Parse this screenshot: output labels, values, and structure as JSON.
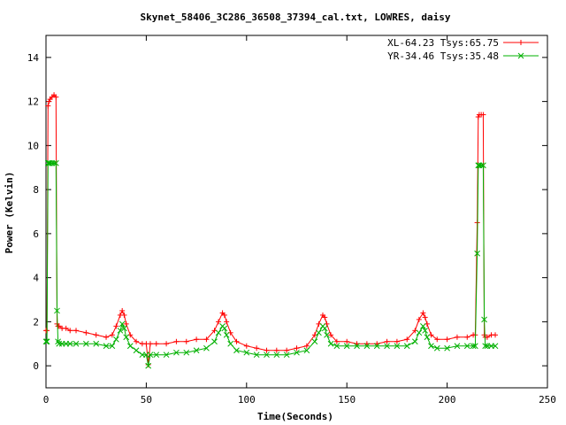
{
  "chart_data": {
    "type": "line",
    "title": "Skynet_58406_3C286_36508_37394_cal.txt, LOWRES, daisy",
    "xlabel": "Time(Seconds)",
    "ylabel": "Power (Kelvin)",
    "xlim": [
      0,
      250
    ],
    "ylim": [
      -1,
      15
    ],
    "xticks": [
      0,
      50,
      100,
      150,
      200,
      250
    ],
    "yticks": [
      0,
      2,
      4,
      6,
      8,
      10,
      12,
      14
    ],
    "grid": false,
    "legend_position": "top-right",
    "series": [
      {
        "name": "XL-64.23 Tsys:65.75",
        "color": "#ff0000",
        "marker": "plus",
        "x": [
          0,
          0.5,
          1,
          1.5,
          2,
          3,
          4,
          5,
          5.5,
          6,
          6.5,
          8,
          10,
          12,
          15,
          20,
          25,
          30,
          33,
          35,
          37,
          38,
          39,
          40,
          42,
          45,
          48,
          50,
          51,
          52,
          55,
          60,
          65,
          70,
          75,
          80,
          84,
          86,
          88,
          89,
          90,
          92,
          95,
          100,
          105,
          110,
          115,
          120,
          125,
          130,
          134,
          136,
          138,
          139,
          140,
          142,
          145,
          150,
          155,
          160,
          165,
          170,
          175,
          180,
          184,
          186,
          188,
          189,
          190,
          192,
          195,
          200,
          205,
          210,
          213,
          214,
          215,
          215.5,
          216,
          217,
          218,
          218.5,
          219,
          220,
          222,
          224
        ],
        "y": [
          1.6,
          1.6,
          11.8,
          12.0,
          12.1,
          12.2,
          12.3,
          12.2,
          1.9,
          1.8,
          1.8,
          1.7,
          1.7,
          1.6,
          1.6,
          1.5,
          1.4,
          1.3,
          1.4,
          1.8,
          2.3,
          2.5,
          2.3,
          1.9,
          1.4,
          1.1,
          1.0,
          1.0,
          0.05,
          1.0,
          1.0,
          1.0,
          1.1,
          1.1,
          1.2,
          1.2,
          1.6,
          2.0,
          2.4,
          2.3,
          2.0,
          1.5,
          1.1,
          0.9,
          0.8,
          0.7,
          0.7,
          0.7,
          0.8,
          0.9,
          1.4,
          1.9,
          2.3,
          2.2,
          1.9,
          1.4,
          1.1,
          1.1,
          1.0,
          1.0,
          1.0,
          1.1,
          1.1,
          1.2,
          1.6,
          2.1,
          2.4,
          2.2,
          1.9,
          1.4,
          1.2,
          1.2,
          1.3,
          1.3,
          1.4,
          1.4,
          6.5,
          11.3,
          11.4,
          11.4,
          11.4,
          1.4,
          1.3,
          1.3,
          1.4,
          1.4
        ]
      },
      {
        "name": "YR-34.46 Tsys:35.48",
        "color": "#00b000",
        "marker": "cross",
        "x": [
          0,
          0.5,
          1,
          1.5,
          2,
          3,
          4,
          5,
          5.5,
          6,
          6.5,
          8,
          10,
          12,
          15,
          20,
          25,
          30,
          33,
          35,
          37,
          38,
          39,
          40,
          42,
          45,
          48,
          50,
          51,
          52,
          55,
          60,
          65,
          70,
          75,
          80,
          84,
          86,
          88,
          89,
          90,
          92,
          95,
          100,
          105,
          110,
          115,
          120,
          125,
          130,
          134,
          136,
          138,
          139,
          140,
          142,
          145,
          150,
          155,
          160,
          165,
          170,
          175,
          180,
          184,
          186,
          188,
          189,
          190,
          192,
          195,
          200,
          205,
          210,
          213,
          214,
          215,
          215.5,
          216,
          217,
          218,
          218.5,
          219,
          220,
          222,
          224
        ],
        "y": [
          1.1,
          1.1,
          9.2,
          9.2,
          9.2,
          9.2,
          9.2,
          9.2,
          2.5,
          1.1,
          1.0,
          1.0,
          1.0,
          1.0,
          1.0,
          1.0,
          1.0,
          0.9,
          0.9,
          1.2,
          1.6,
          1.9,
          1.7,
          1.3,
          0.9,
          0.7,
          0.5,
          0.5,
          0.0,
          0.5,
          0.5,
          0.5,
          0.6,
          0.6,
          0.7,
          0.8,
          1.1,
          1.5,
          1.8,
          1.7,
          1.4,
          1.0,
          0.7,
          0.6,
          0.5,
          0.5,
          0.5,
          0.5,
          0.6,
          0.7,
          1.1,
          1.5,
          1.8,
          1.7,
          1.4,
          1.0,
          0.9,
          0.9,
          0.9,
          0.9,
          0.9,
          0.9,
          0.9,
          0.9,
          1.1,
          1.5,
          1.8,
          1.6,
          1.3,
          0.9,
          0.8,
          0.8,
          0.9,
          0.9,
          0.9,
          0.9,
          5.1,
          9.1,
          9.1,
          9.1,
          9.1,
          2.1,
          0.9,
          0.9,
          0.9,
          0.9
        ]
      }
    ]
  }
}
